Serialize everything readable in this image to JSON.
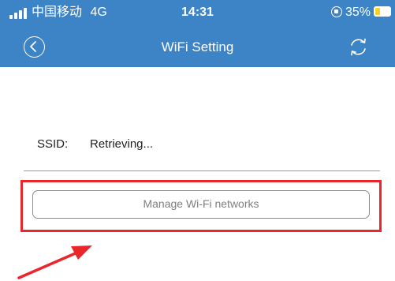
{
  "status_bar": {
    "carrier": "中国移动",
    "network": "4G",
    "time": "14:31",
    "battery_percent": "35%",
    "battery_level": 0.35,
    "battery_color": "#f5d327"
  },
  "header": {
    "title": "WiFi Setting",
    "back_icon": "chevron-left-icon",
    "refresh_icon": "refresh-icon",
    "background_color": "#3d84c7"
  },
  "ssid": {
    "label": "SSID:",
    "value": "Retrieving..."
  },
  "manage_button": {
    "label": "Manage Wi-Fi networks"
  },
  "annotation": {
    "highlight_color": "#e8262b"
  }
}
